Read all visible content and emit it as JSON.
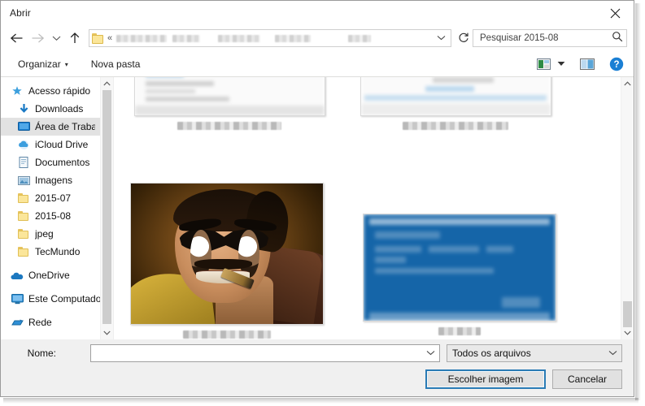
{
  "window": {
    "title": "Abrir",
    "close_label": "Fechar"
  },
  "navbar": {
    "back_icon": "arrow-left-icon",
    "forward_icon": "arrow-right-icon",
    "recent_icon": "chevron-down-icon",
    "up_icon": "arrow-up-icon",
    "address": {
      "folder_icon": "folder-icon",
      "overflow": "«",
      "crumbs_redacted": true,
      "dropdown_icon": "chevron-down-icon",
      "refresh_icon": "refresh-icon"
    },
    "search": {
      "placeholder": "Pesquisar 2015-08",
      "icon": "search-icon"
    }
  },
  "commandbar": {
    "organize_label": "Organizar",
    "organize_caret": "▾",
    "new_folder_label": "Nova pasta",
    "view_icon": "view-options-icon",
    "view_caret": "▾",
    "preview_pane_icon": "preview-pane-icon",
    "help_icon": "help-icon",
    "help_glyph": "?"
  },
  "sidebar": {
    "items": [
      {
        "label": "Acesso rápido",
        "icon": "star-icon",
        "pinned": false,
        "indent": false,
        "selected": false
      },
      {
        "label": "Downloads",
        "icon": "download-icon",
        "pinned": true,
        "indent": true,
        "selected": false
      },
      {
        "label": "Área de Traba",
        "icon": "desktop-icon",
        "pinned": true,
        "indent": true,
        "selected": true
      },
      {
        "label": "iCloud Drive",
        "icon": "cloud-icon",
        "pinned": true,
        "indent": true,
        "selected": false
      },
      {
        "label": "Documentos",
        "icon": "documents-icon",
        "pinned": true,
        "indent": true,
        "selected": false
      },
      {
        "label": "Imagens",
        "icon": "pictures-icon",
        "pinned": true,
        "indent": true,
        "selected": false
      },
      {
        "label": "2015-07",
        "icon": "folder-icon",
        "pinned": false,
        "indent": true,
        "selected": false
      },
      {
        "label": "2015-08",
        "icon": "folder-icon",
        "pinned": false,
        "indent": true,
        "selected": false
      },
      {
        "label": "jpeg",
        "icon": "folder-icon",
        "pinned": false,
        "indent": true,
        "selected": false
      },
      {
        "label": "TecMundo",
        "icon": "folder-icon",
        "pinned": false,
        "indent": true,
        "selected": false
      }
    ],
    "roots": [
      {
        "label": "OneDrive",
        "icon": "onedrive-icon"
      },
      {
        "label": "Este Computador",
        "icon": "this-pc-icon"
      },
      {
        "label": "Rede",
        "icon": "network-icon"
      }
    ],
    "scrollbar": {
      "up_icon": "chevron-up-icon",
      "down_icon": "chevron-down-icon"
    }
  },
  "filepane": {
    "tiles": [
      {
        "name": "thumbnail-screenshot-top-left",
        "caption_redacted": true,
        "kind": "blur-shot"
      },
      {
        "name": "thumbnail-screenshot-top-right",
        "caption_redacted": true,
        "kind": "blur-shot"
      },
      {
        "name": "thumbnail-photo-masked-man",
        "caption_redacted": true,
        "kind": "photo"
      },
      {
        "name": "thumbnail-screenshot-blue",
        "caption_redacted": true,
        "kind": "blue-shot"
      }
    ],
    "scrollbar": {
      "up_icon": "chevron-up-icon",
      "down_icon": "chevron-down-icon"
    }
  },
  "footer": {
    "filename_label": "Nome:",
    "filename_value": "",
    "filename_caret": "⌄",
    "filetype_value": "Todos os arquivos",
    "filetype_caret": "⌄",
    "open_button": "Escolher imagem",
    "cancel_button": "Cancelar"
  },
  "colors": {
    "accent": "#2a7bb5",
    "help_blue": "#1a7fd4",
    "folder_yellow": "#fbe69a",
    "selection_gray": "#e2e2e2"
  }
}
